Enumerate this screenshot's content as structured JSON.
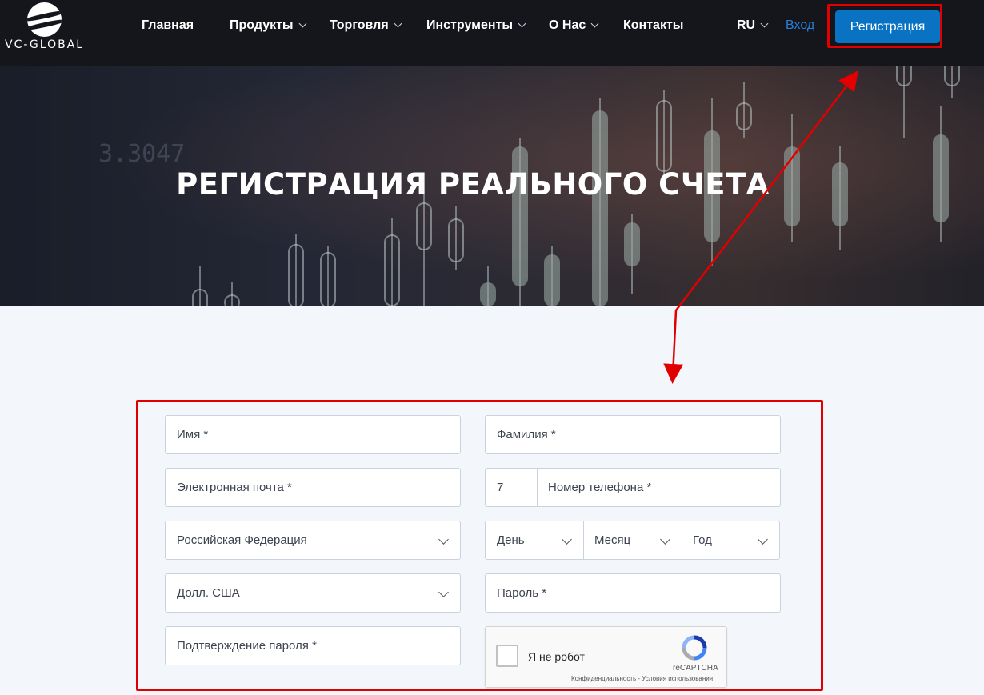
{
  "header": {
    "logo_text": "VC-GLOBAL",
    "nav": [
      {
        "label": "Главная",
        "has_dropdown": false
      },
      {
        "label": "Продукты",
        "has_dropdown": true
      },
      {
        "label": "Торговля",
        "has_dropdown": true
      },
      {
        "label": "Инструменты",
        "has_dropdown": true
      },
      {
        "label": "О Нас",
        "has_dropdown": true
      },
      {
        "label": "Контакты",
        "has_dropdown": false
      }
    ],
    "language": "RU",
    "login_label": "Вход",
    "register_label": "Регистрация"
  },
  "hero": {
    "ticker": "3.3047",
    "title": "РЕГИСТРАЦИЯ РЕАЛЬНОГО СЧЕТА"
  },
  "form": {
    "first_name_placeholder": "Имя *",
    "last_name_placeholder": "Фамилия *",
    "email_placeholder": "Электронная почта *",
    "phone_code": "7",
    "phone_placeholder": "Номер телефона *",
    "country_selected": "Российская Федерация",
    "birth_day": "День",
    "birth_month": "Месяц",
    "birth_year": "Год",
    "currency_selected": "Долл. США",
    "password_placeholder": "Пароль *",
    "password_confirm_placeholder": "Подтверждение пароля *"
  },
  "captcha": {
    "label": "Я не робот",
    "brand": "reCAPTCHA",
    "terms": "Конфиденциальность - Условия использования"
  },
  "colors": {
    "header_bg": "#14161c",
    "accent_blue": "#0a72c3",
    "annotation_red": "#e00000",
    "page_bg": "#f3f7fb"
  }
}
